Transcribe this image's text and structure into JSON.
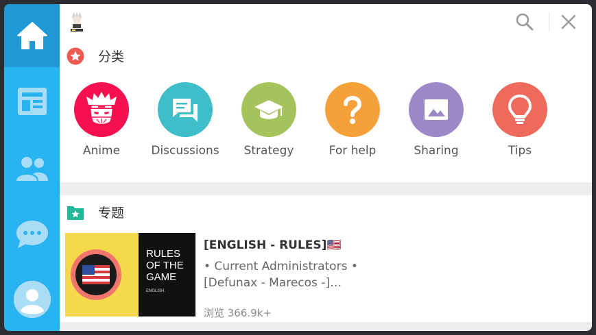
{
  "colors": {
    "sidebar": "#2ab3f1",
    "sidebar_active": "#1e99d6",
    "categories_star": "#ee5a4f",
    "topics_folder": "#21b897"
  },
  "header": {
    "search_icon": "search-icon",
    "close_icon": "close-icon"
  },
  "sidebar": {
    "items": [
      {
        "icon": "home-icon"
      },
      {
        "icon": "feed-icon"
      },
      {
        "icon": "members-icon"
      },
      {
        "icon": "chat-icon"
      },
      {
        "icon": "profile-icon"
      }
    ]
  },
  "categories": {
    "title": "分类",
    "items": [
      {
        "label": "Anime",
        "color": "#f5104f",
        "icon": "anime-avatar-icon"
      },
      {
        "label": "Discussions",
        "color": "#3fbdc8",
        "icon": "chat-bubbles-icon"
      },
      {
        "label": "Strategy",
        "color": "#a4c35c",
        "icon": "graduation-cap-icon"
      },
      {
        "label": "For help",
        "color": "#f5a13a",
        "icon": "question-icon"
      },
      {
        "label": "Sharing",
        "color": "#9b88c4",
        "icon": "image-icon"
      },
      {
        "label": "Tips",
        "color": "#ee6a5c",
        "icon": "lightbulb-icon"
      }
    ]
  },
  "topics": {
    "title": "专题",
    "post": {
      "title": "[ENGLISH - RULES]🇺🇸",
      "excerpt": "• Current Administrators • [Defunax - Marecos -]…",
      "views": "浏览 366.9k+",
      "thumb_text": "RULES\nOF THE\nGAME",
      "thumb_sub": "ENGLISH."
    }
  }
}
